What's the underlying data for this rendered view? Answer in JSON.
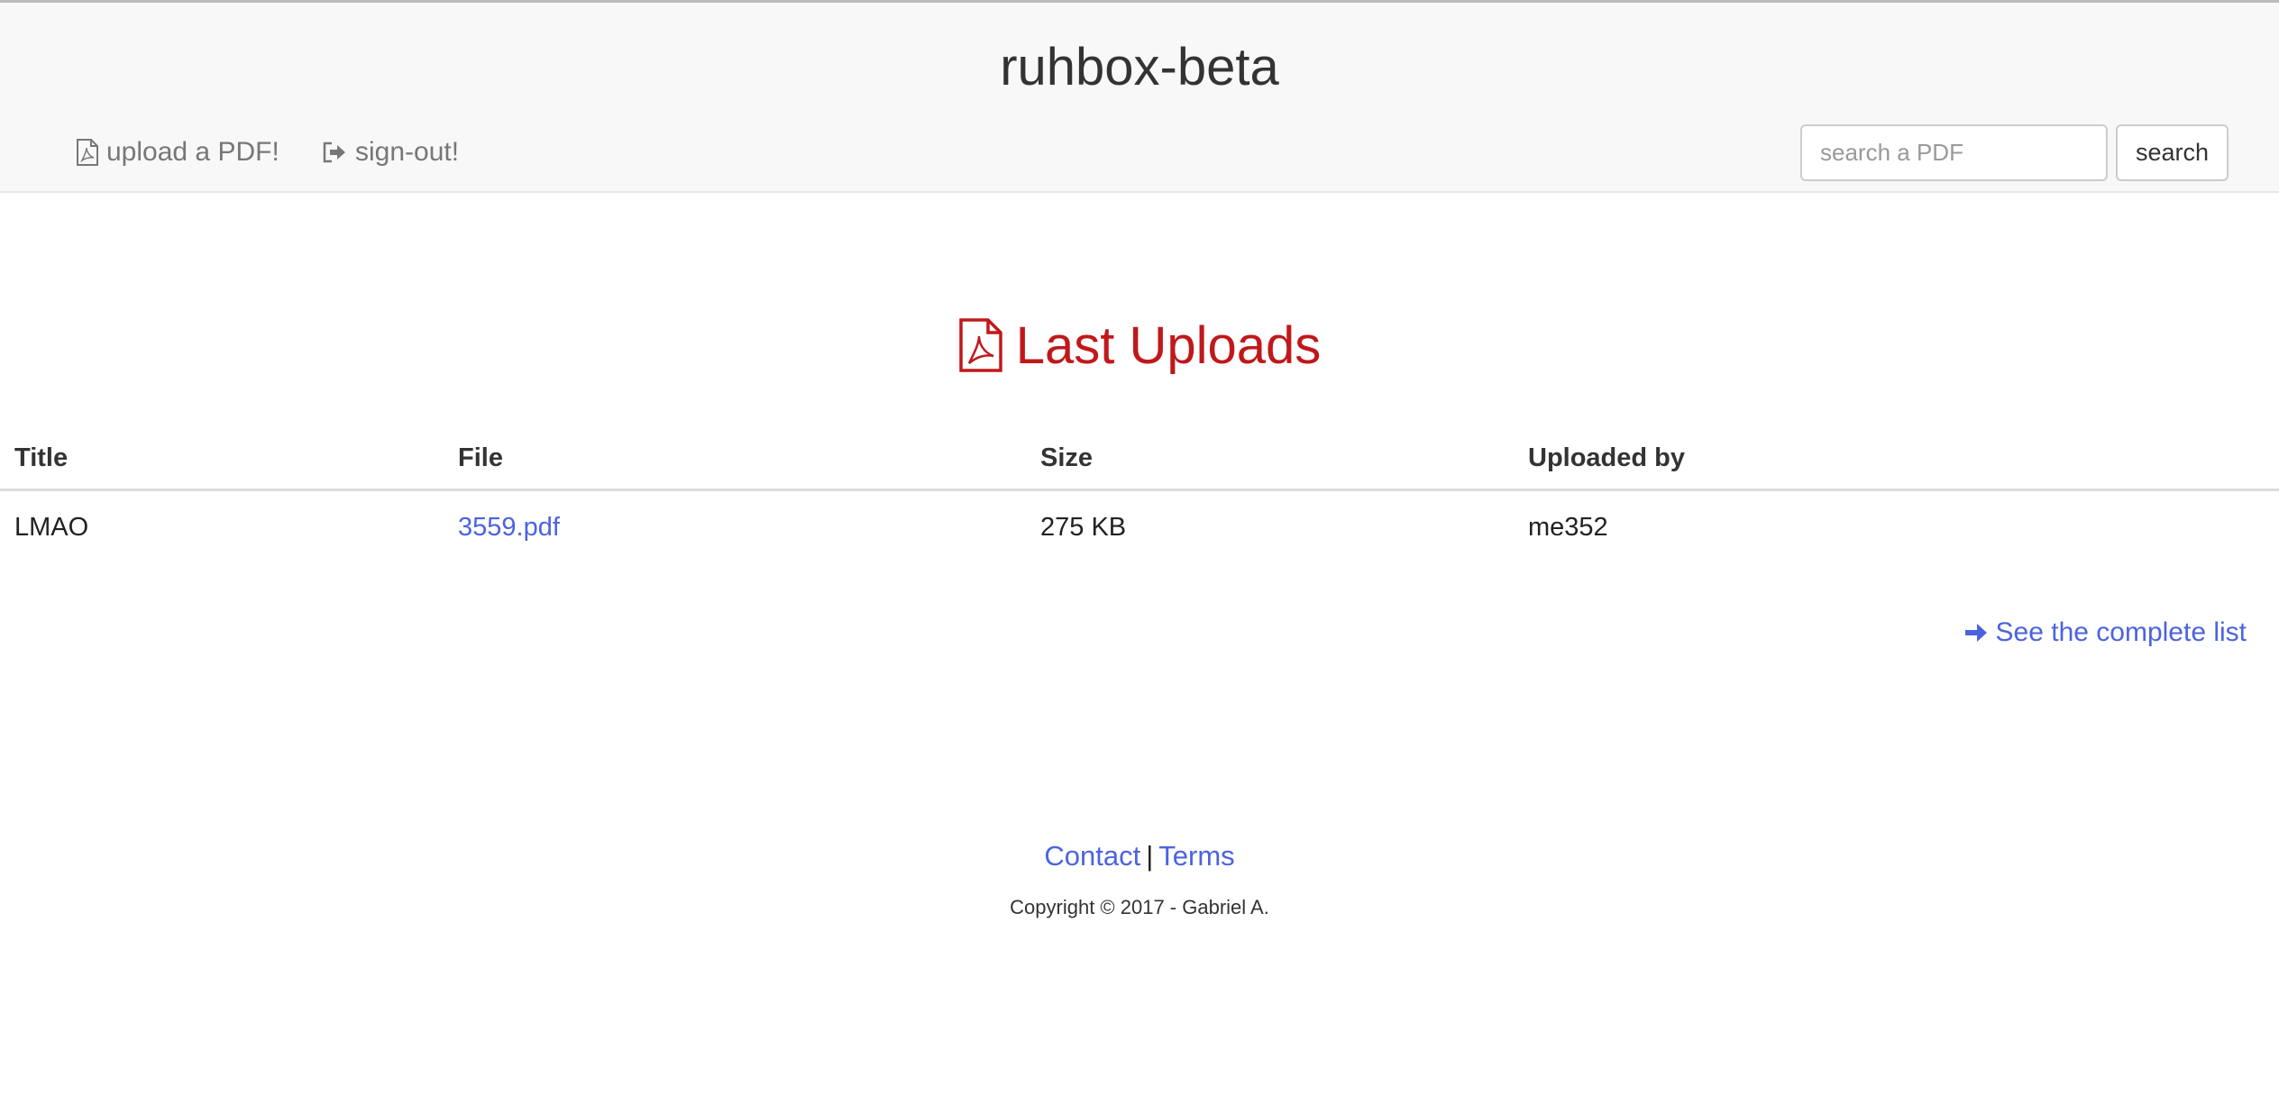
{
  "navbar": {
    "brand": "ruhbox-beta",
    "upload_link": "upload a PDF!",
    "signout_link": "sign-out!",
    "search_placeholder": "search a PDF",
    "search_button": "search"
  },
  "main": {
    "heading": "Last Uploads",
    "table": {
      "columns": [
        "Title",
        "File",
        "Size",
        "Uploaded by"
      ],
      "rows": [
        {
          "title": "LMAO",
          "file": "3559.pdf",
          "size": "275 KB",
          "uploaded_by": "me352"
        }
      ]
    },
    "see_all_link": "See the complete list"
  },
  "footer": {
    "contact": "Contact",
    "separator": "|",
    "terms": "Terms",
    "copyright": "Copyright © 2017 - Gabriel A."
  },
  "icons": {
    "upload": "file-pdf-icon",
    "signout": "sign-out-icon",
    "heading": "file-pdf-icon",
    "see_all": "arrow-right-icon"
  },
  "colors": {
    "accent_link": "#4b63e0",
    "heading_red": "#c0181b",
    "navbar_bg": "#f8f8f8"
  }
}
